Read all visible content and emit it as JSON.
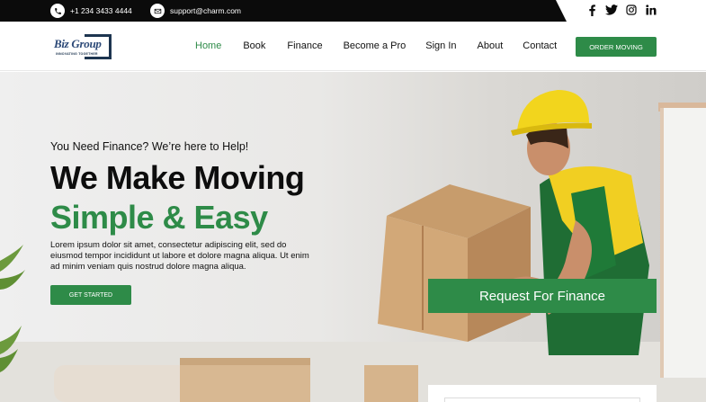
{
  "topbar": {
    "phone": "+1 234 3433 4444",
    "email": "support@charm.com",
    "social_icons": [
      "facebook-icon",
      "twitter-icon",
      "instagram-icon",
      "linkedin-icon"
    ]
  },
  "logo": {
    "name": "Biz Group",
    "tagline": "INNOVATING TOGETHER"
  },
  "nav": {
    "items": [
      {
        "label": "Home",
        "active": true
      },
      {
        "label": "Book",
        "active": false
      },
      {
        "label": "Finance",
        "active": false
      },
      {
        "label": "Become a Pro",
        "active": false
      },
      {
        "label": "Sign In",
        "active": false
      },
      {
        "label": "About",
        "active": false
      },
      {
        "label": "Contact",
        "active": false
      }
    ],
    "order_button": "ORDER MOVING"
  },
  "hero": {
    "eyebrow": "You Need Finance? We’re here to Help!",
    "headline_line1": "We Make Moving",
    "headline_line2": "Simple & Easy",
    "description": "Lorem ipsum dolor sit amet, consectetur adipiscing elit, sed do eiusmod tempor incididunt ut labore et dolore magna aliqua. Ut enim ad minim veniam quis nostrud dolore magna aliqua.",
    "cta": "GET STARTED"
  },
  "request_panel": {
    "title": "Request For Finance"
  },
  "colors": {
    "accent": "#2e8b48",
    "topbar": "#0b0b0b",
    "text": "#111111"
  }
}
